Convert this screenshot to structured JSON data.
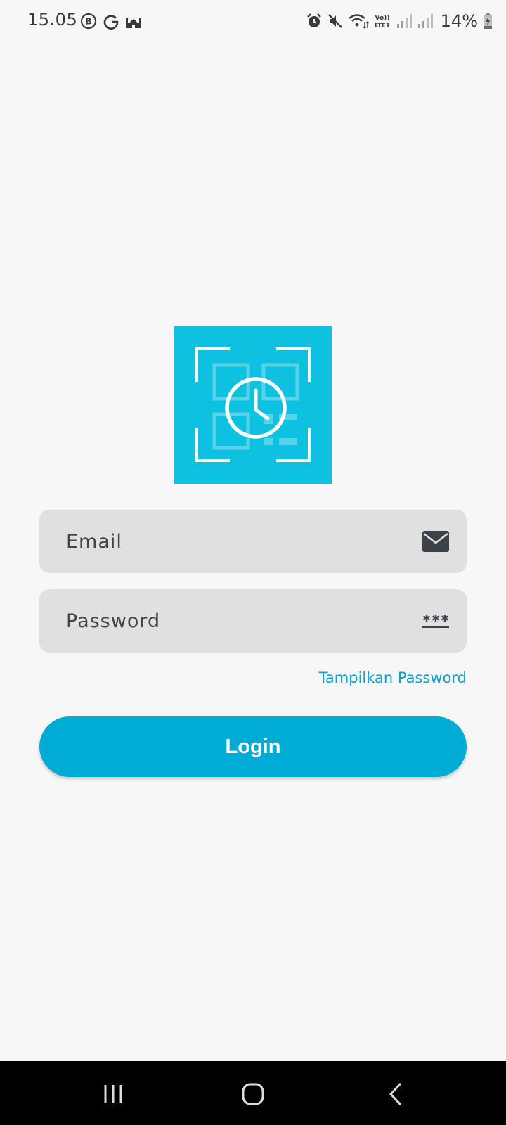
{
  "status_bar": {
    "time": "15.05",
    "battery_percent": "14%",
    "left_icons": [
      "bbm-icon",
      "g-icon",
      "mosque-icon"
    ],
    "right_icons": [
      "alarm-icon",
      "mute-icon",
      "wifi-icon",
      "volte-icon",
      "signal-icon",
      "signal-icon",
      "battery-icon"
    ]
  },
  "logo": {
    "icon": "qr-clock-icon",
    "background_color": "#0fc1e0"
  },
  "login_form": {
    "email": {
      "placeholder": "Email",
      "value": "",
      "icon": "mail-icon"
    },
    "password": {
      "placeholder": "Password",
      "value": "",
      "icon": "password-icon"
    },
    "show_password_label": "Tampilkan Password",
    "login_label": "Login",
    "accent_color": "#00acd6"
  },
  "nav_bar": {
    "buttons": [
      "recents-icon",
      "home-icon",
      "back-icon"
    ]
  }
}
